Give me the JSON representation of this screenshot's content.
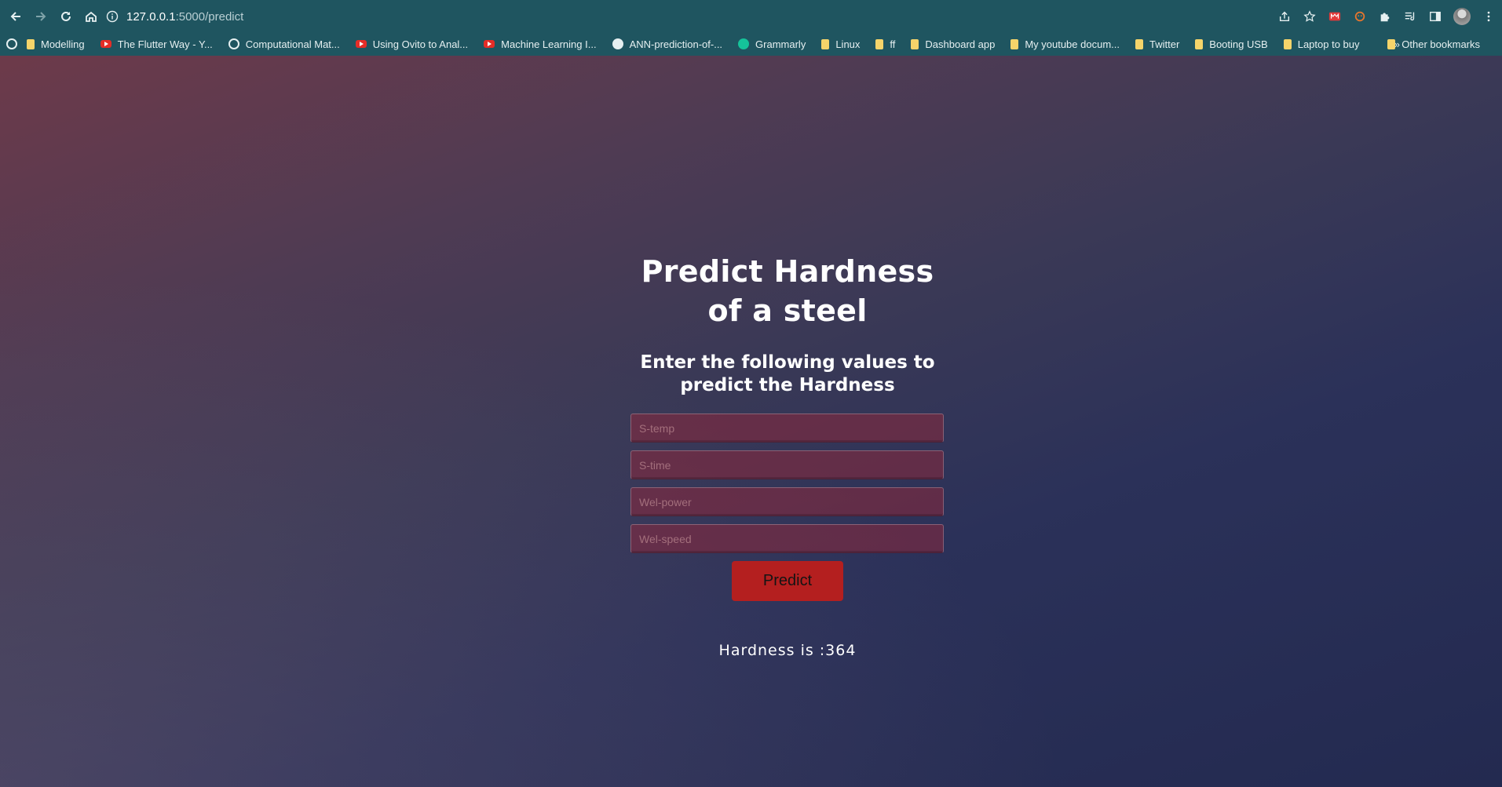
{
  "browser": {
    "url_host": "127.0.0.1",
    "url_path": ":5000/predict",
    "bookmarks": [
      {
        "label": "Modelling",
        "icon": "folder"
      },
      {
        "label": "The Flutter Way - Y...",
        "icon": "youtube"
      },
      {
        "label": "Computational Mat...",
        "icon": "globe"
      },
      {
        "label": "Using Ovito to Anal...",
        "icon": "youtube"
      },
      {
        "label": "Machine Learning I...",
        "icon": "youtube"
      },
      {
        "label": "ANN-prediction-of-...",
        "icon": "github"
      },
      {
        "label": "Grammarly",
        "icon": "grammarly"
      },
      {
        "label": "Linux",
        "icon": "folder"
      },
      {
        "label": "ff",
        "icon": "folder"
      },
      {
        "label": "Dashboard app",
        "icon": "folder"
      },
      {
        "label": "My youtube docum...",
        "icon": "folder"
      },
      {
        "label": "Twitter",
        "icon": "folder"
      },
      {
        "label": "Booting USB",
        "icon": "folder"
      },
      {
        "label": "Laptop to buy",
        "icon": "folder"
      }
    ],
    "more_label": "»",
    "other_bookmarks": "Other bookmarks",
    "colors": {
      "chrome": "#1f5560"
    }
  },
  "form": {
    "title": "Predict Hardness of a steel",
    "subtitle": "Enter the following values to predict the Hardness",
    "fields": [
      {
        "placeholder": "S-temp",
        "value": ""
      },
      {
        "placeholder": "S-time",
        "value": ""
      },
      {
        "placeholder": "Wel-power",
        "value": ""
      },
      {
        "placeholder": "Wel-speed",
        "value": ""
      }
    ],
    "button_label": "Predict",
    "result_text": "Hardness is :364",
    "colors": {
      "button": "#b41f1f",
      "field": "#8c283c"
    }
  }
}
